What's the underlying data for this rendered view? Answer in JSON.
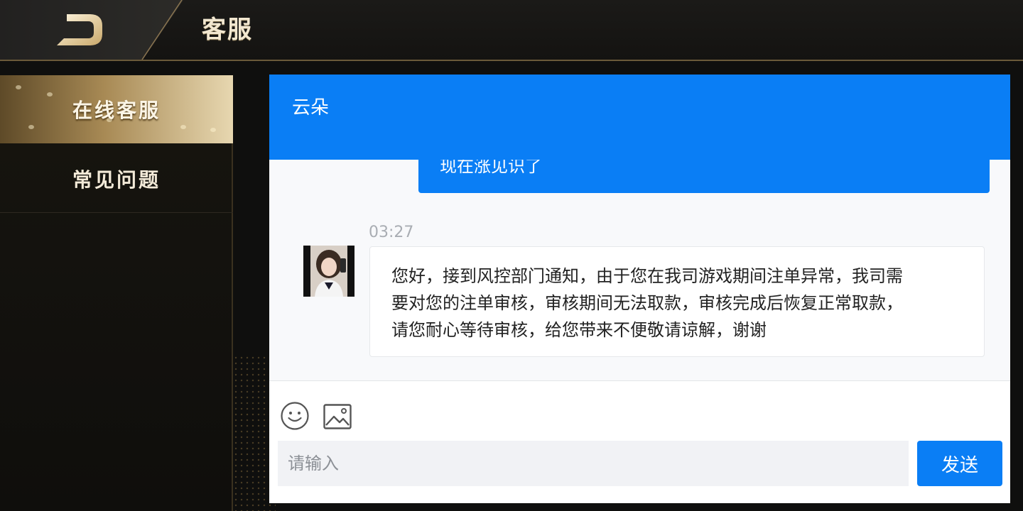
{
  "header": {
    "title": "客服",
    "logo_icon": "d-logo-icon"
  },
  "sidebar": {
    "items": [
      {
        "label": "在线客服",
        "active": true
      },
      {
        "label": "常见问题",
        "active": false
      }
    ]
  },
  "chat": {
    "agent_name": "云朵",
    "messages": [
      {
        "direction": "outgoing",
        "text": "现在涨见识了"
      },
      {
        "direction": "incoming",
        "time": "03:27",
        "avatar": "agent-avatar",
        "lines": [
          "您好，接到风控部门通知，由于您在我司游戏期间注单异常，我司需",
          "要对您的注单审核，审核期间无法取款，审核完成后恢复正常取款，",
          "请您耐心等待审核，给您带来不便敬请谅解，谢谢"
        ]
      }
    ],
    "composer": {
      "emoji_icon": "smiley-icon",
      "image_icon": "image-icon",
      "placeholder": "请输入",
      "value": "",
      "send_label": "发送"
    }
  },
  "colors": {
    "accent": "#0a7ef5",
    "gold": "#d9c49a",
    "background": "#0f0f0e"
  }
}
